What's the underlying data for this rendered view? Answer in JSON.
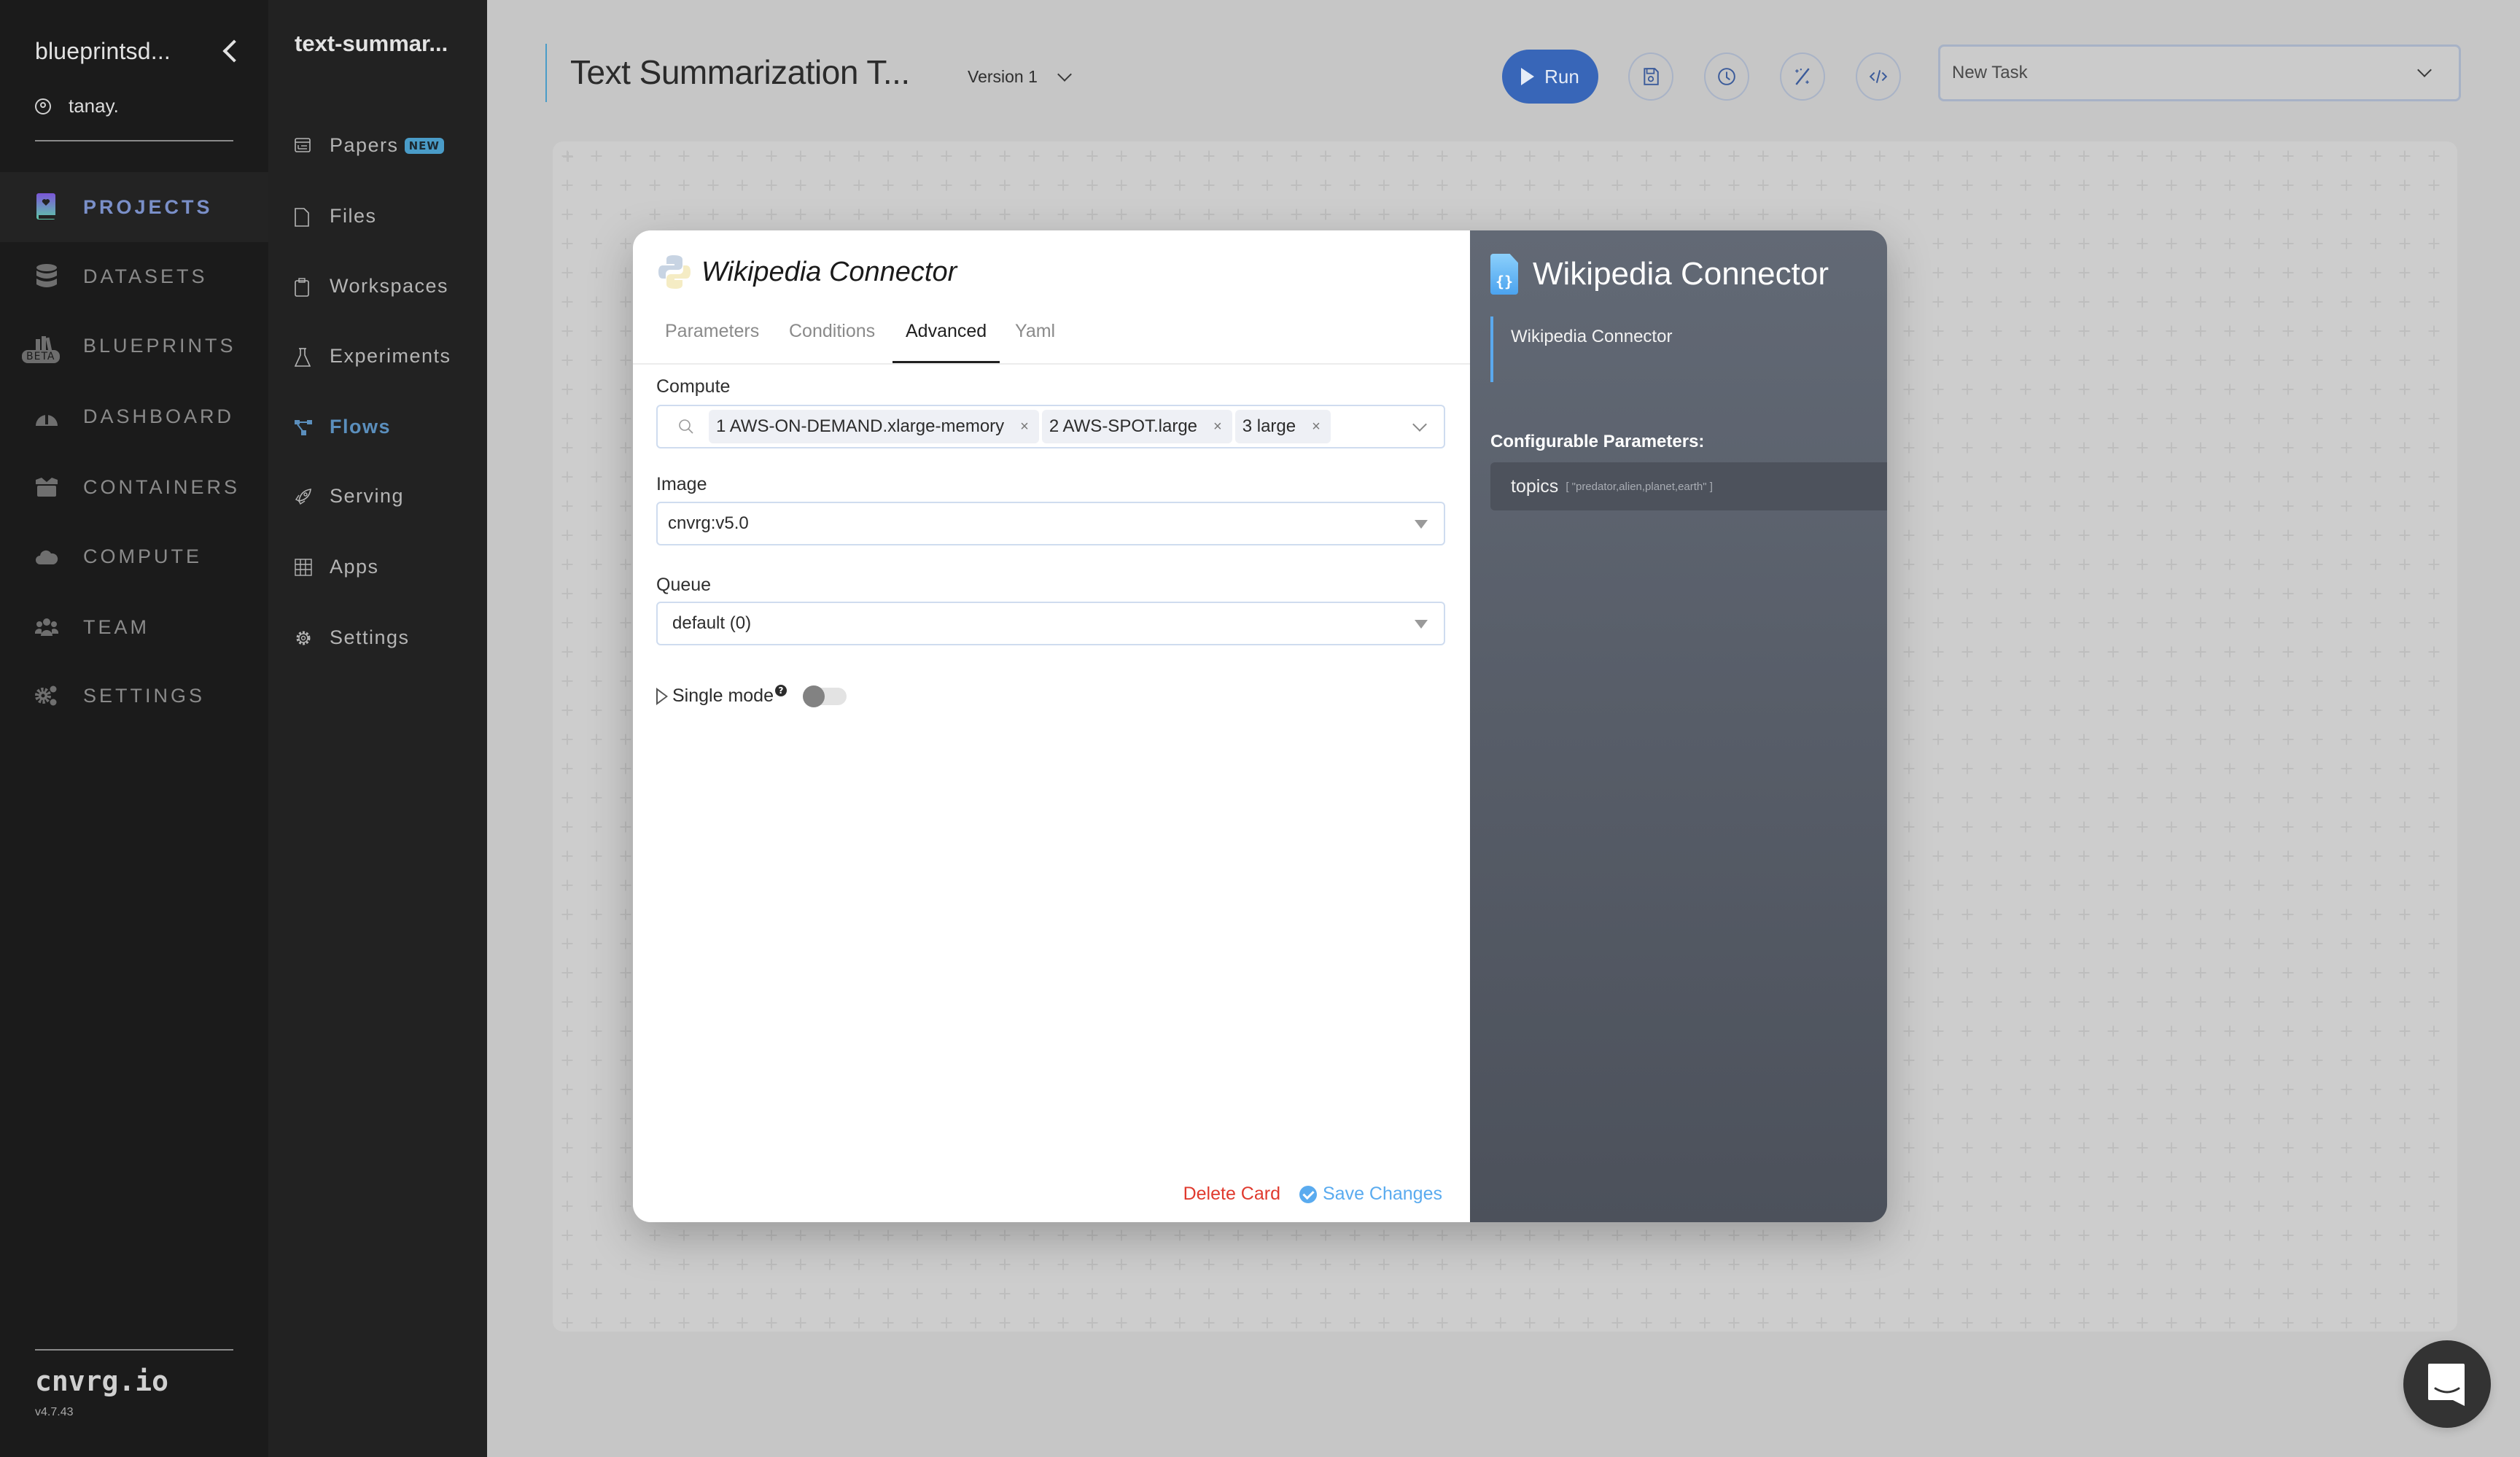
{
  "sidebar": {
    "org_name": "blueprintsd...",
    "user_name": "tanay.",
    "items": [
      {
        "label": "PROJECTS",
        "icon": "projects-book-icon",
        "active": true
      },
      {
        "label": "DATASETS",
        "icon": "database-icon",
        "active": false
      },
      {
        "label": "BLUEPRINTS",
        "icon": "blueprints-icon",
        "active": false,
        "badge": "BETA"
      },
      {
        "label": "DASHBOARD",
        "icon": "dashboard-gauge-icon",
        "active": false
      },
      {
        "label": "CONTAINERS",
        "icon": "containers-box-icon",
        "active": false
      },
      {
        "label": "COMPUTE",
        "icon": "cloud-icon",
        "active": false
      },
      {
        "label": "TEAM",
        "icon": "team-icon",
        "active": false
      },
      {
        "label": "SETTINGS",
        "icon": "gears-icon",
        "active": false
      }
    ],
    "brand": "cnvrg.io",
    "version": "v4.7.43"
  },
  "project_nav": {
    "project_name": "text-summar...",
    "items": [
      {
        "label": "Papers",
        "icon": "papers-icon",
        "badge": "NEW",
        "active": false
      },
      {
        "label": "Files",
        "icon": "file-icon",
        "active": false
      },
      {
        "label": "Workspaces",
        "icon": "clipboard-icon",
        "active": false
      },
      {
        "label": "Experiments",
        "icon": "flask-icon",
        "active": false
      },
      {
        "label": "Flows",
        "icon": "flows-icon",
        "active": true
      },
      {
        "label": "Serving",
        "icon": "rocket-icon",
        "active": false
      },
      {
        "label": "Apps",
        "icon": "grid-icon",
        "active": false
      },
      {
        "label": "Settings",
        "icon": "gear-icon",
        "active": false
      }
    ]
  },
  "header": {
    "title": "Text Summarization T...",
    "version_label": "Version 1",
    "run_label": "Run",
    "task_select_value": "New Task",
    "icon_buttons": [
      "save-icon",
      "history-clock-icon",
      "magic-wand-icon",
      "code-icon"
    ]
  },
  "modal": {
    "title": "Wikipedia Connector",
    "tabs": [
      "Parameters",
      "Conditions",
      "Advanced",
      "Yaml"
    ],
    "active_tab": "Advanced",
    "compute": {
      "label": "Compute",
      "chips": [
        "1 AWS-ON-DEMAND.xlarge-memory",
        "2 AWS-SPOT.large",
        "3 large"
      ]
    },
    "image": {
      "label": "Image",
      "value": "cnvrg:v5.0"
    },
    "queue": {
      "label": "Queue",
      "value": "default (0)"
    },
    "single_mode": {
      "label": "Single mode",
      "help": "?",
      "enabled": false
    },
    "delete_label": "Delete Card",
    "save_label": "Save Changes",
    "info": {
      "title": "Wikipedia Connector",
      "description": "Wikipedia Connector",
      "configurable_label": "Configurable Parameters:",
      "params": [
        {
          "name": "topics",
          "value": "[ \"predator,alien,planet,earth\" ]"
        }
      ]
    }
  },
  "colors": {
    "accent_blue": "#3866b8",
    "flows_active": "#5b8fbd",
    "delete_red": "#e03a2e",
    "save_blue": "#5aabef",
    "new_badge": "#4a9cc8"
  }
}
